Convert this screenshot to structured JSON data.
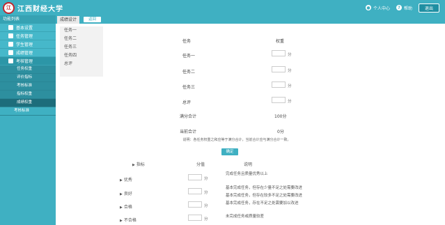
{
  "header": {
    "logo_text": "江西财经大学",
    "logo_seal": "江",
    "user_label": "个人中心",
    "help_label": "帮助",
    "logout_label": "退出"
  },
  "sidebar": {
    "title": "功能列表",
    "items": [
      {
        "label": "基本设置"
      },
      {
        "label": "任务管理"
      },
      {
        "label": "学生管理"
      },
      {
        "label": "成绩管理"
      },
      {
        "label": "考核管理"
      }
    ],
    "subitems": [
      {
        "label": "任务权重"
      },
      {
        "label": "评价指标"
      },
      {
        "label": "考核标准"
      },
      {
        "label": "指标权重"
      },
      {
        "label": "成绩权重"
      }
    ],
    "extra": {
      "label": "考核标准"
    }
  },
  "tabbar": {
    "current_tab": "成绩设计",
    "tab_button": "返回"
  },
  "dropdown": {
    "items": [
      "任务一",
      "任务二",
      "任务三",
      "任务四",
      "总评"
    ]
  },
  "weights_table": {
    "col_task": "任务",
    "col_score": "权重",
    "rows": [
      {
        "label": "任务一",
        "unit": "分"
      },
      {
        "label": "任务二",
        "unit": "分"
      },
      {
        "label": "任务三",
        "unit": "分"
      },
      {
        "label": "总评",
        "unit": "分"
      }
    ],
    "total_label": "满分合计",
    "total_value": "100分",
    "current_label": "当前合计",
    "current_value": "0分"
  },
  "note": "说明：各任务权重之和应等于满分合计，当前合计应与满分合计一致。",
  "submit_label": "确定",
  "criteria_table": {
    "col_item": "指标",
    "col_score": "分值",
    "col_desc": "说明",
    "rows": [
      {
        "label": "优秀",
        "unit": "分",
        "desc": "完成任务且质量优秀以上"
      },
      {
        "label": "良好",
        "unit": "分",
        "desc": "基本完成任务，但存在少量不足之处需要改进"
      },
      {
        "label": "合格",
        "unit": "分",
        "desc": "基本完成任务，但存在较多不足之处需要改进"
      },
      {
        "label": "不合格",
        "unit": "分",
        "desc": "未完成任务或质量较差"
      }
    ],
    "extra_desc": "基本完成任务，存在不足之处需要加以改进"
  }
}
